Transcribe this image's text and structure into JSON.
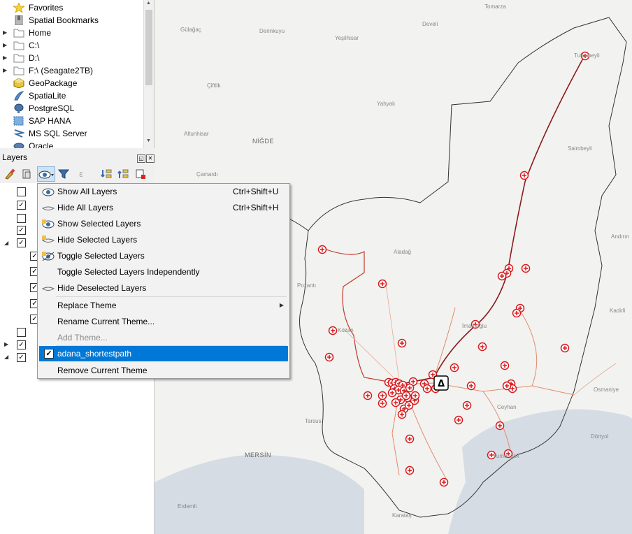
{
  "browser": {
    "items": [
      {
        "label": "Favorites",
        "icon": "star-icon"
      },
      {
        "label": "Spatial Bookmarks",
        "icon": "bookmark-icon"
      },
      {
        "label": "Home",
        "icon": "folder-icon"
      },
      {
        "label": "C:\\",
        "icon": "folder-icon"
      },
      {
        "label": "D:\\",
        "icon": "folder-icon"
      },
      {
        "label": "F:\\ (Seagate2TB)",
        "icon": "folder-icon"
      },
      {
        "label": "GeoPackage",
        "icon": "geopackage-icon"
      },
      {
        "label": "SpatiaLite",
        "icon": "spatialite-icon"
      },
      {
        "label": "PostgreSQL",
        "icon": "postgresql-icon"
      },
      {
        "label": "SAP HANA",
        "icon": "sap-hana-icon"
      },
      {
        "label": "MS SQL Server",
        "icon": "mssql-icon"
      },
      {
        "label": "Oracle",
        "icon": "oracle-icon"
      }
    ]
  },
  "layers_panel": {
    "title": "Layers"
  },
  "theme_menu": {
    "items": [
      {
        "label": "Show All Layers",
        "shortcut": "Ctrl+Shift+U"
      },
      {
        "label": "Hide All Layers",
        "shortcut": "Ctrl+Shift+H"
      },
      {
        "label": "Show Selected Layers",
        "shortcut": ""
      },
      {
        "label": "Hide Selected Layers",
        "shortcut": ""
      },
      {
        "label": "Toggle Selected Layers",
        "shortcut": ""
      },
      {
        "label": "Toggle Selected Layers Independently",
        "shortcut": ""
      },
      {
        "label": "Hide Deselected Layers",
        "shortcut": ""
      }
    ],
    "theme_items": [
      {
        "label": "Replace Theme"
      },
      {
        "label": "Rename Current Theme..."
      },
      {
        "label": "Add Theme..."
      }
    ],
    "themes": [
      {
        "label": "adana_shortestpath",
        "checked": true
      }
    ],
    "remove_label": "Remove Current Theme"
  },
  "map": {
    "places": [
      "Tomarza",
      "Gülağaç",
      "Derinkuyu",
      "Yeşilhisar",
      "Develi",
      "Tufanbeyli",
      "Çiftlik",
      "Yahyalı",
      "Altunhisar",
      "NİĞDE",
      "Saimbeyli",
      "Çamardı",
      "Aladağ",
      "Andırın",
      "Pozantı",
      "Kozan",
      "Kadirli",
      "İmamoğlu",
      "Osmaniye",
      "Tarsus",
      "MERSİN",
      "Yumurtalık",
      "Dörtyol",
      "Erdemli",
      "Karataş",
      "Ceyhan"
    ],
    "accent_color": "#d7191c"
  }
}
